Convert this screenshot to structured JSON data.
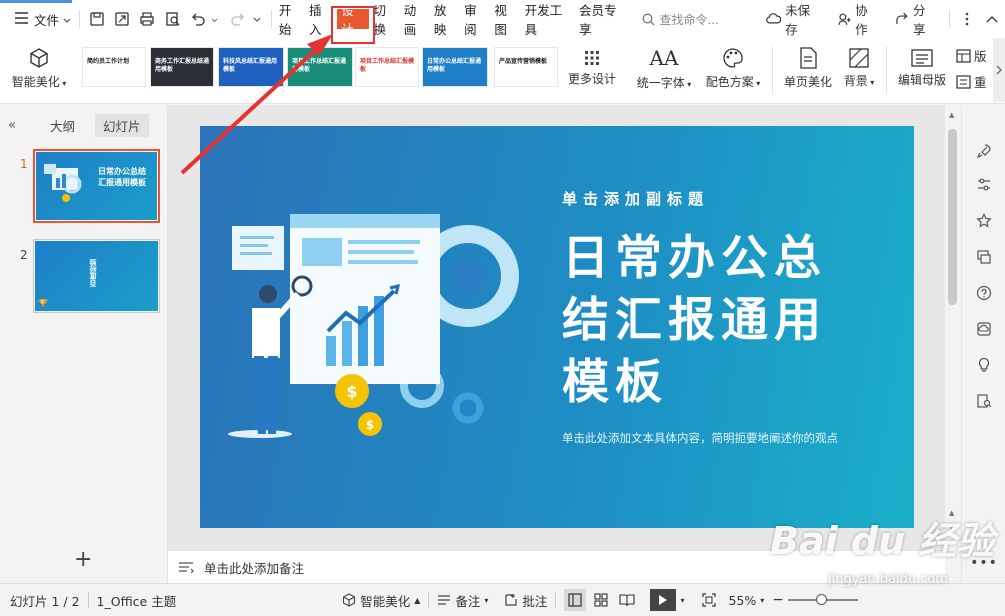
{
  "menubar": {
    "file_label": "文件",
    "tabs": [
      "开始",
      "插入",
      "设计",
      "切换",
      "动画",
      "放映",
      "审阅",
      "视图",
      "开发工具",
      "会员专享"
    ],
    "active_tab": "设计",
    "search_placeholder": "查找命令...",
    "unsaved_label": "未保存",
    "collab_label": "协作",
    "share_label": "分享"
  },
  "ribbon": {
    "smart_beautify": "智能美化",
    "more_designs": "更多设计",
    "unify_font": "统一字体",
    "color_scheme": "配色方案",
    "page_beautify": "单页美化",
    "background": "背景",
    "edit_master": "编辑母版",
    "layout_cut": "版",
    "rearrange_cut": "重",
    "thumbnails": [
      {
        "text": "简约员工作计划",
        "bg": "#ffffff",
        "fg": "#222222"
      },
      {
        "text": "商务工作汇报总结通用模板",
        "bg": "#2c2f38",
        "fg": "#ffffff"
      },
      {
        "text": "科技风总结汇报通用模板",
        "bg": "#1f5fbf",
        "fg": "#ffffff"
      },
      {
        "text": "项目工作总结汇报通用模板",
        "bg": "#1a8d7a",
        "fg": "#ffffff"
      },
      {
        "text": "项目工作总结汇报模板",
        "bg": "#ffffff",
        "fg": "#d33"
      },
      {
        "text": "日常办公总结汇报通用模板",
        "bg": "#1e7fc8",
        "fg": "#ffffff"
      },
      {
        "text": "产品宣传营销模板",
        "bg": "#ffffff",
        "fg": "#222222"
      }
    ]
  },
  "leftpanel": {
    "tab_outline": "大纲",
    "tab_slides": "幻灯片",
    "slides": [
      {
        "num": "1",
        "title": "日常办公总结汇报通用模板"
      },
      {
        "num": "2",
        "title": "百度经验"
      }
    ],
    "add_label": "+"
  },
  "slide": {
    "subtitle": "单击添加副标题",
    "title_lines": [
      "日常办公总",
      "结汇报通用",
      "模板"
    ],
    "description": "单击此处添加文本具体内容，简明扼要地阐述你的观点"
  },
  "notes": {
    "placeholder": "单击此处添加备注"
  },
  "status": {
    "slide_counter": "幻灯片 1 / 2",
    "theme": "1_Office 主题",
    "smart_beautify": "智能美化",
    "notes": "备注",
    "comments": "批注",
    "zoom": "55%"
  },
  "watermark": {
    "brand": "Bai du 经验",
    "url": "jingyan.baidu.com"
  },
  "colors": {
    "accent": "#e8572e",
    "highlight_box": "#e53333",
    "arrow": "#e53333",
    "slide_bg": "#1e8dc4"
  }
}
